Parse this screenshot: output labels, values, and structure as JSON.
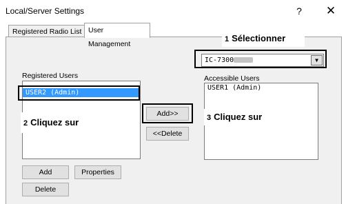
{
  "window": {
    "title": "Local/Server Settings",
    "help_glyph": "?",
    "close_glyph": "✕"
  },
  "tabs": [
    {
      "label": "Registered Radio List",
      "active": false
    },
    {
      "label": "User Management",
      "active": true
    }
  ],
  "radio_select": {
    "value": "IC-7300"
  },
  "registered_users": {
    "label": "Registered Users",
    "items": [
      "USER2 (Admin)"
    ],
    "selected_index": 0
  },
  "accessible_users": {
    "label": "Accessible Users",
    "items": [
      "USER1 (Admin)"
    ]
  },
  "buttons": {
    "add_right": "Add>>",
    "delete_left": "<<Delete",
    "add": "Add",
    "properties": "Properties",
    "delete": "Delete"
  },
  "callouts": [
    {
      "num": "1",
      "text": "Sélectionner"
    },
    {
      "num": "2",
      "text": "Cliquez sur"
    },
    {
      "num": "3",
      "text": "Cliquez sur"
    }
  ],
  "colors": {
    "selection": "#3399ff",
    "panel": "#f0f0f0"
  }
}
